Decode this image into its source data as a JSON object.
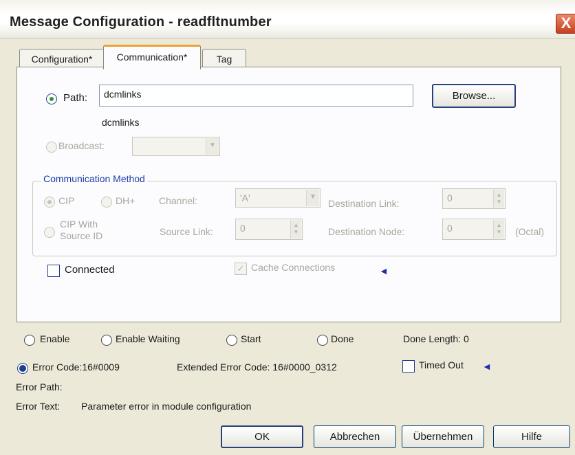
{
  "window": {
    "title": "Message Configuration - readfltnumber",
    "close_label": "X"
  },
  "tabs": [
    {
      "label": "Configuration*"
    },
    {
      "label": "Communication*"
    },
    {
      "label": "Tag"
    }
  ],
  "communication": {
    "path_label": "Path:",
    "path_value": "dcmlinks",
    "path_resolved": "dcmlinks",
    "browse_label": "Browse...",
    "broadcast_label": "Broadcast:",
    "method_group_label": "Communication Method",
    "cip_label": "CIP",
    "dhplus_label": "DH+",
    "channel_label": "Channel:",
    "channel_value": "'A'",
    "destination_link_label": "Destination Link:",
    "destination_link_value": "0",
    "cip_source_id_label_line1": "CIP With",
    "cip_source_id_label_line2": "Source ID",
    "source_link_label": "Source Link:",
    "source_link_value": "0",
    "destination_node_label": "Destination Node:",
    "destination_node_value": "0",
    "octal_label": "(Octal)",
    "connected_label": "Connected",
    "cache_connections_label": "Cache Connections"
  },
  "status": {
    "enable_label": "Enable",
    "enable_waiting_label": "Enable Waiting",
    "start_label": "Start",
    "done_label": "Done",
    "done_length_label": "Done Length: 0",
    "error_code_label": "Error Code:16#0009",
    "extended_error_label": "Extended Error Code: 16#0000_0312",
    "timed_out_label": "Timed Out",
    "error_path_label": "Error Path:",
    "error_text_label": "Error Text:",
    "error_text_value": "Parameter error in module configuration"
  },
  "buttons": {
    "ok": "OK",
    "cancel": "Abbrechen",
    "apply": "Übernehmen",
    "help": "Hilfe"
  },
  "icons": {
    "arrow_marker": "blue-left-arrow-icon",
    "dropdown": "chevron-down-icon",
    "spinner": "spin-arrows-icon"
  },
  "colors": {
    "title_close": "#c4401f",
    "tab_active_accent": "#f0a030",
    "group_label": "#1a3ea8",
    "radio_selected_green": "#2a9a2a",
    "radio_selected_blue": "#1f3e8a",
    "arrow_marker": "#1a2fb0"
  }
}
